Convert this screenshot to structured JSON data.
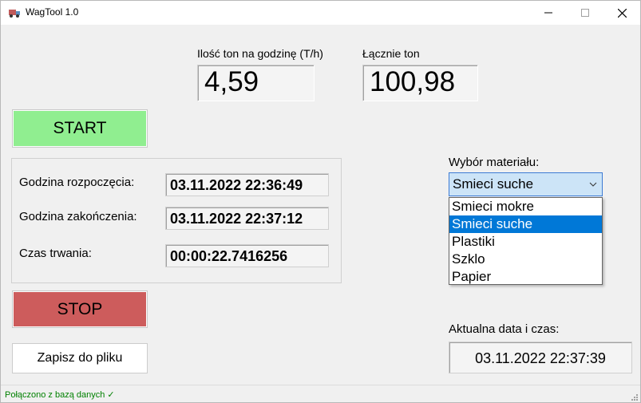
{
  "window": {
    "title": "WagTool 1.0"
  },
  "rate": {
    "label": "Ilość ton na godzinę (T/h)",
    "value": "4,59"
  },
  "total": {
    "label": "Łącznie ton",
    "value": "100,98"
  },
  "buttons": {
    "start": "START",
    "stop": "STOP",
    "save": "Zapisz do pliku"
  },
  "times": {
    "start_label": "Godzina rozpoczęcia:",
    "start_value": "03.11.2022 22:36:49",
    "end_label": "Godzina zakończenia:",
    "end_value": "03.11.2022 22:37:12",
    "duration_label": "Czas trwania:",
    "duration_value": "00:00:22.7416256"
  },
  "material": {
    "label": "Wybór materiału:",
    "selected": "Smieci suche",
    "options": [
      "Smieci mokre",
      "Smieci suche",
      "Plastiki",
      "Szklo",
      "Papier"
    ]
  },
  "clock": {
    "label": "Aktualna data i czas:",
    "value": "03.11.2022 22:37:39"
  },
  "status": {
    "text": "Połączono z bazą danych ✓"
  },
  "colors": {
    "start_button": "#90ee90",
    "stop_button": "#cd5c5c",
    "selection": "#0078d7",
    "status_text": "#008000"
  }
}
